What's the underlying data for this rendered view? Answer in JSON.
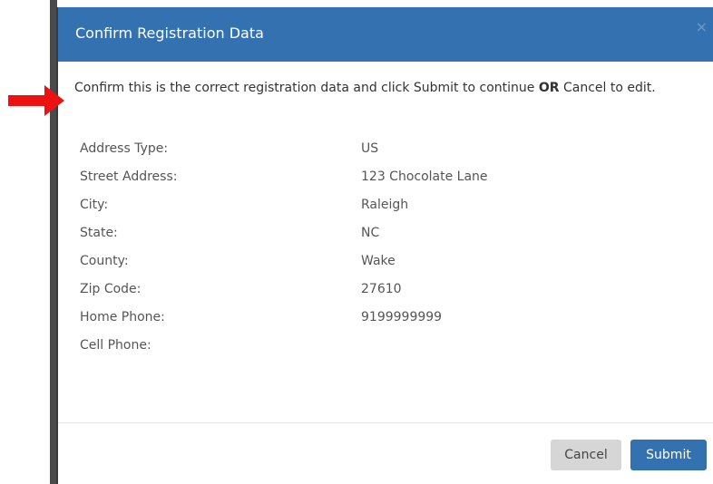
{
  "modal": {
    "title": "Confirm Registration Data",
    "close_glyph": "×",
    "intro_before": "Confirm this is the correct registration data and click Submit to continue ",
    "intro_bold": "OR",
    "intro_after": " Cancel to edit.",
    "fields": [
      {
        "label": "Address Type:",
        "value": "US"
      },
      {
        "label": "Street Address:",
        "value": "123 Chocolate Lane"
      },
      {
        "label": "City:",
        "value": "Raleigh"
      },
      {
        "label": "State:",
        "value": "NC"
      },
      {
        "label": "County:",
        "value": "Wake"
      },
      {
        "label": "Zip Code:",
        "value": "27610"
      },
      {
        "label": "Home Phone:",
        "value": "9199999999"
      },
      {
        "label": "Cell Phone:",
        "value": ""
      }
    ],
    "cancel_label": "Cancel",
    "submit_label": "Submit"
  },
  "annotation": {
    "arrow_icon": "red-arrow-right-icon",
    "arrow_color": "#ee1111"
  },
  "colors": {
    "header": "#3471b0",
    "submit": "#3471b0",
    "cancel": "#d6d6d6"
  }
}
